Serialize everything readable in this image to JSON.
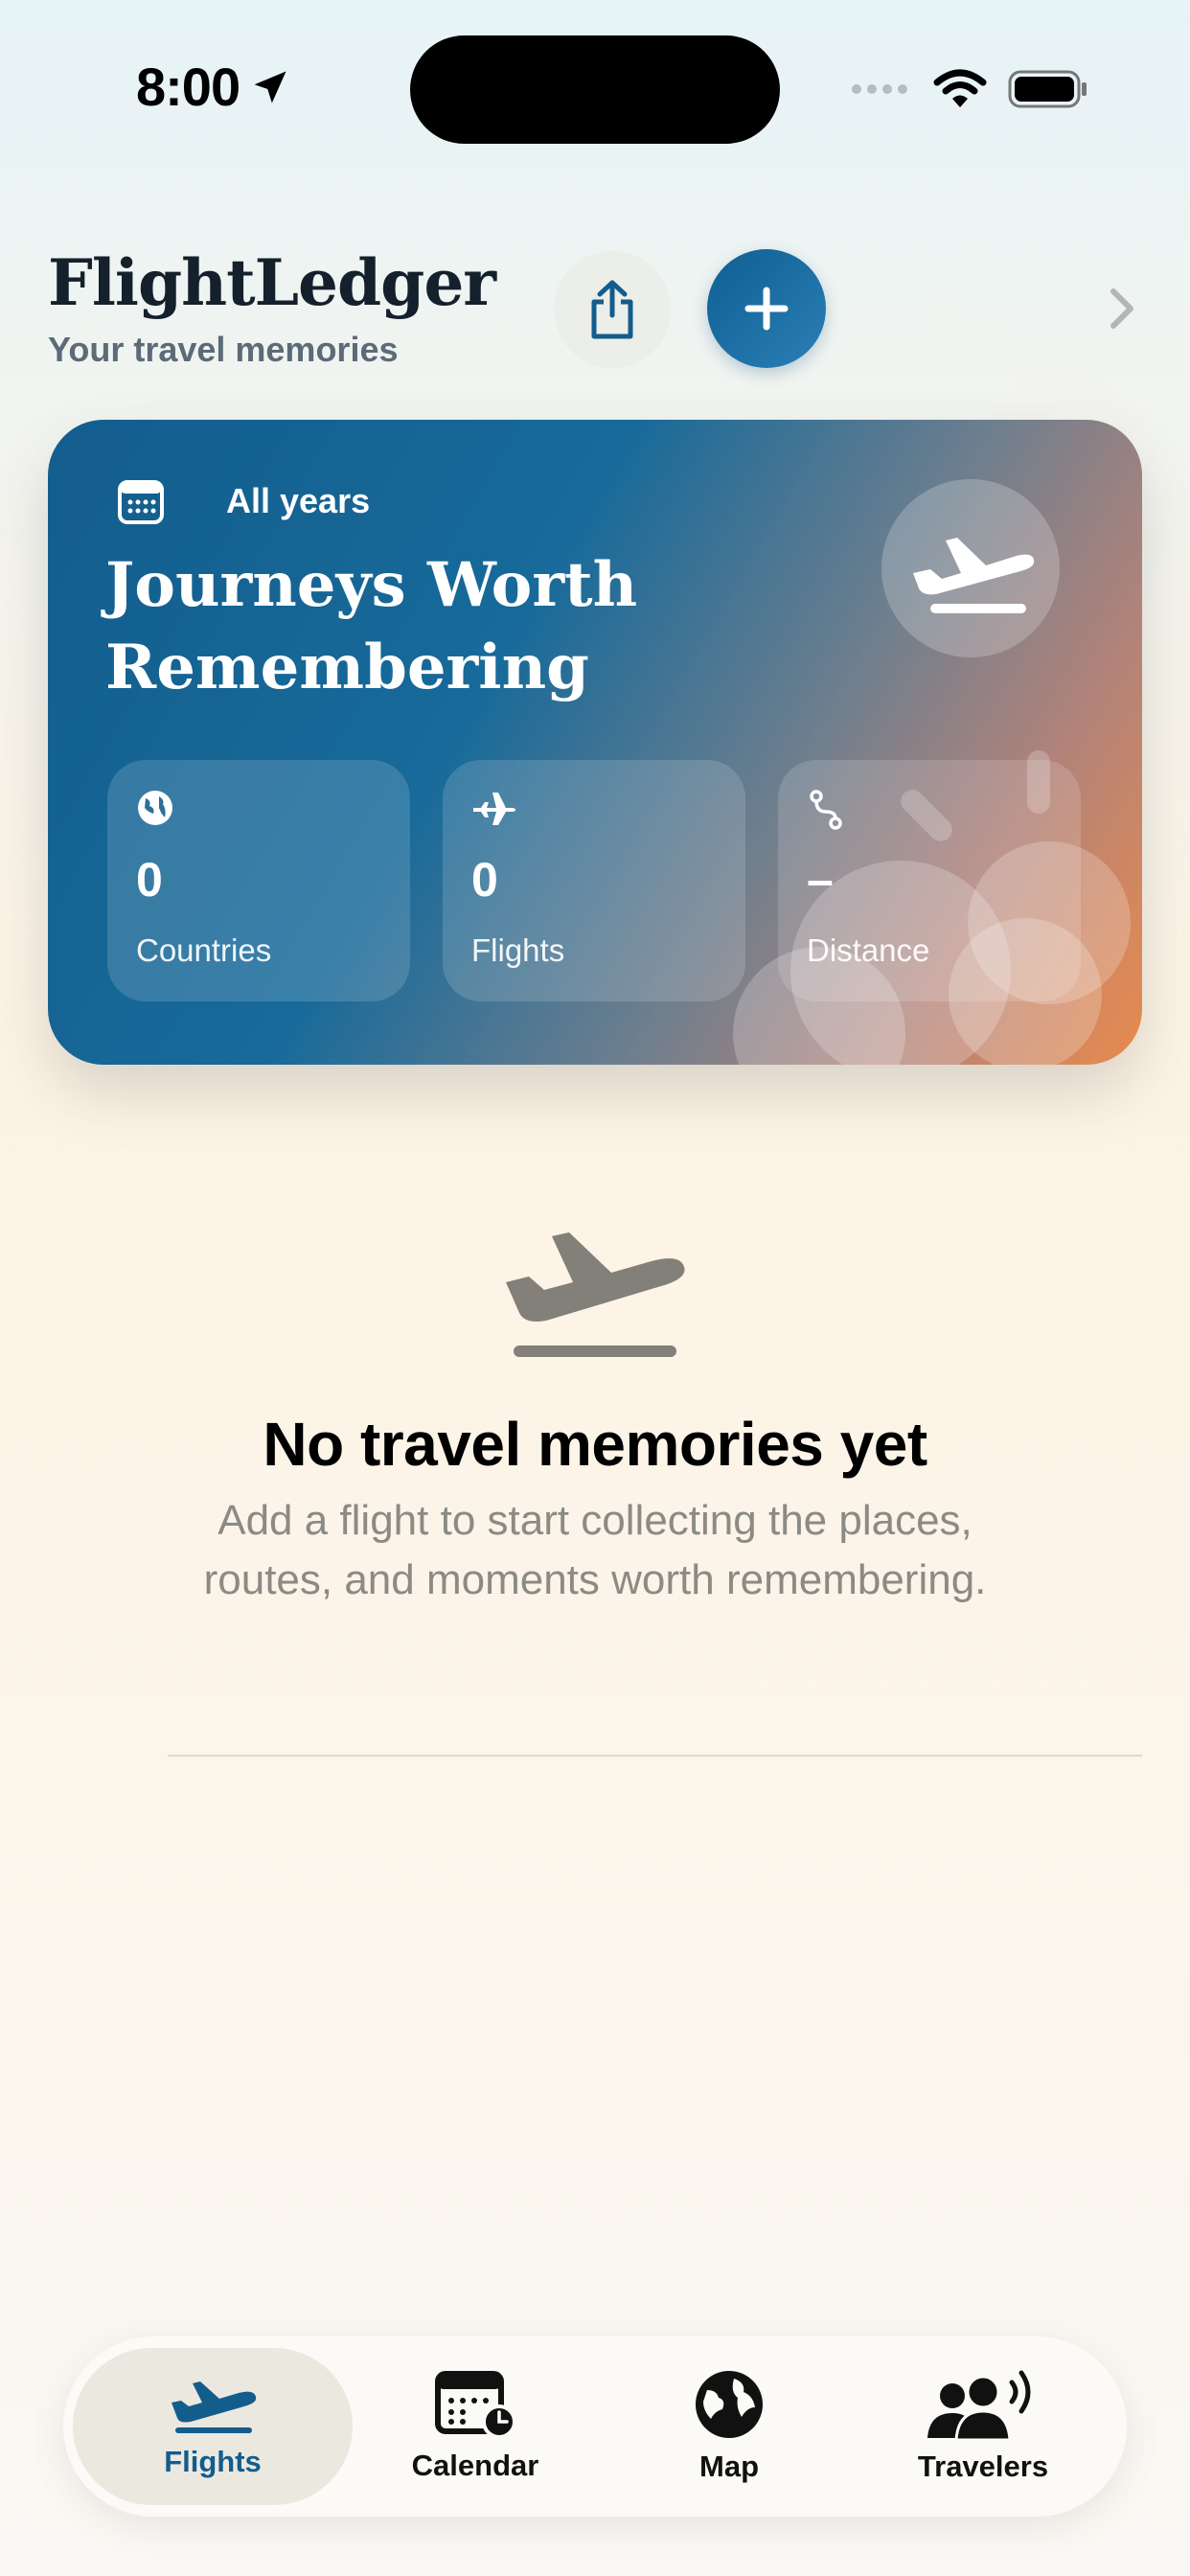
{
  "status_bar": {
    "time": "8:00"
  },
  "header": {
    "title": "FlightLedger",
    "subtitle": "Your travel memories",
    "share_icon": "share-icon",
    "add_icon": "plus-icon",
    "chevron_icon": "chevron-right-icon"
  },
  "hero": {
    "filter_label": "All years",
    "title_line1": "Journeys Worth",
    "title_line2": "Remembering",
    "stats": [
      {
        "icon": "globe-icon",
        "value": "0",
        "label": "Countries"
      },
      {
        "icon": "airplane-icon",
        "value": "0",
        "label": "Flights"
      },
      {
        "icon": "route-icon",
        "value": "–",
        "label": "Distance"
      }
    ]
  },
  "empty_state": {
    "title": "No travel memories yet",
    "description_line1": "Add a flight to start collecting the places,",
    "description_line2": "routes, and moments worth remembering."
  },
  "tabbar": {
    "tabs": [
      {
        "label": "Flights",
        "icon": "airplane-departure-icon",
        "active": true
      },
      {
        "label": "Calendar",
        "icon": "calendar-icon",
        "active": false
      },
      {
        "label": "Map",
        "icon": "globe-icon",
        "active": false
      },
      {
        "label": "Travelers",
        "icon": "people-icon",
        "active": false
      }
    ]
  },
  "colors": {
    "accent": "#135d8d",
    "card_start": "#135d8d",
    "card_end": "#e98a4d"
  }
}
